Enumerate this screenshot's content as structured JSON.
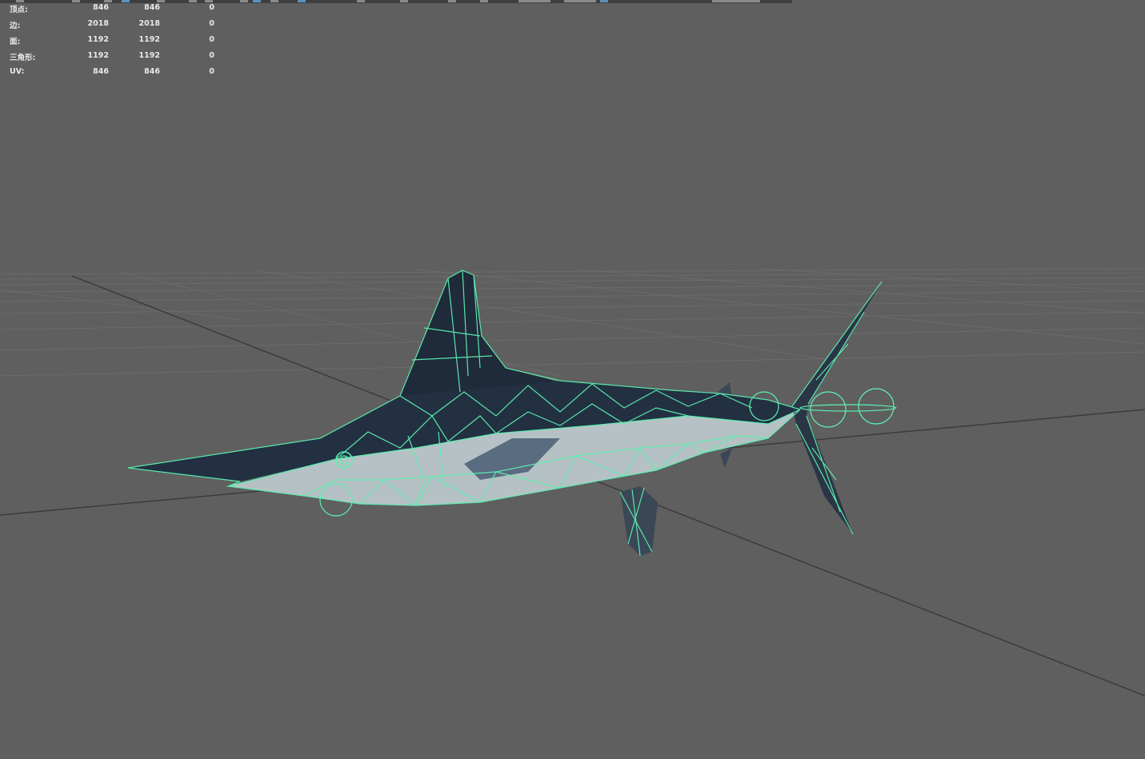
{
  "hud": {
    "rows": [
      {
        "label": "顶点:",
        "v1": "846",
        "v2": "846",
        "v3": "0"
      },
      {
        "label": "边:",
        "v1": "2018",
        "v2": "2018",
        "v3": "0"
      },
      {
        "label": "面:",
        "v1": "1192",
        "v2": "1192",
        "v3": "0"
      },
      {
        "label": "三角形:",
        "v1": "1192",
        "v2": "1192",
        "v3": "0"
      },
      {
        "label": "UV:",
        "v1": "846",
        "v2": "846",
        "v3": "0"
      }
    ]
  },
  "colors": {
    "viewport_bg": "#5f5f5f",
    "grid": "#6d6d6d",
    "grid_axis": "#3a3a3a",
    "wireframe": "#5cf0b0",
    "body_dark": "#1e2a3a",
    "body_light": "#b9c3c6"
  },
  "icons": [
    "toolbar-icons",
    "wireframe-mesh",
    "joint-controls"
  ]
}
